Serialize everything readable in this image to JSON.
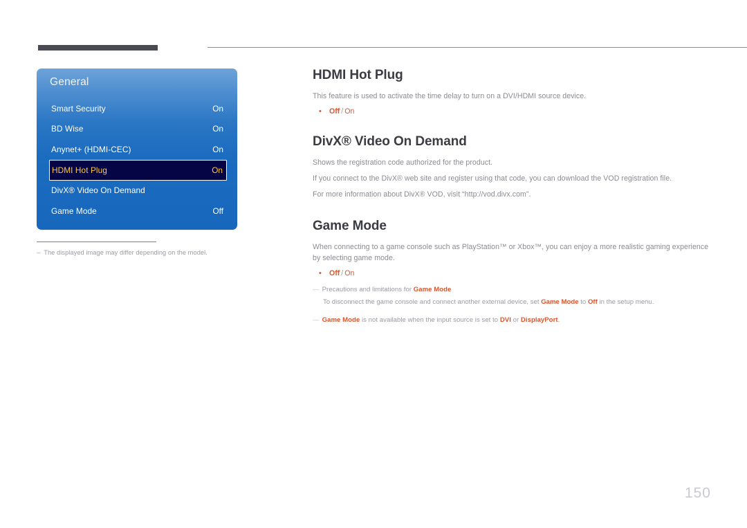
{
  "header": {
    "left_block": "",
    "right_rule": ""
  },
  "osd": {
    "title": "General",
    "rows": [
      {
        "label": "Smart Security",
        "value": "On",
        "selected": false
      },
      {
        "label": "BD Wise",
        "value": "On",
        "selected": false
      },
      {
        "label": "Anynet+ (HDMI-CEC)",
        "value": "On",
        "selected": false
      },
      {
        "label": "HDMI Hot Plug",
        "value": "On",
        "selected": true
      },
      {
        "label": "DivX® Video On Demand",
        "value": "",
        "selected": false
      },
      {
        "label": "Game Mode",
        "value": "Off",
        "selected": false
      }
    ],
    "footnote": {
      "dash": "–",
      "text": "The displayed image may differ depending on the model."
    },
    "colors": {
      "highlight_bg": "#050546",
      "highlight_text": "#ffc83c",
      "panel_blue": "#1b6bbf"
    }
  },
  "content": {
    "section1": {
      "heading": "HDMI Hot Plug",
      "paragraph": "This feature is used to activate the time delay to turn on a DVI/HDMI source device.",
      "bullet": {
        "marker": "•",
        "option_a": "Off",
        "separator": "/",
        "option_b": "On"
      }
    },
    "section2": {
      "heading": "DivX® Video On Demand",
      "paragraph1": "Shows the registration code authorized for the product.",
      "paragraph2": "If you connect to the DivX® web site and register using that code, you can download the VOD registration file.",
      "paragraph3": "For more information about DivX® VOD, visit “http://vod.divx.com”."
    },
    "section3": {
      "heading": "Game Mode",
      "paragraph": "When connecting to a game console such as PlayStation™ or Xbox™, you can enjoy a more realistic gaming experience by selecting game mode.",
      "bullet": {
        "marker": "•",
        "option_a": "Off",
        "separator": "/",
        "option_b": "On"
      },
      "note1": {
        "dash": "—",
        "prefix": "Precautions and limitations for ",
        "term": "Game Mode",
        "sub_prefix": "To disconnect the game console and connect another external device, set ",
        "sub_term1": "Game Mode",
        "sub_mid": " to ",
        "sub_term2": "Off",
        "sub_suffix": " in the setup menu."
      },
      "note2": {
        "dash": "—",
        "term1": "Game Mode",
        "mid": " is not available when the input source is set to ",
        "term2": "DVI",
        "conj": " or ",
        "term3": "DisplayPort",
        "end": "."
      }
    }
  },
  "footer": {
    "page_number": "150"
  },
  "theme": {
    "accent": "#d8562f",
    "body_text": "#8b8b93",
    "heading": "#3b3b44",
    "page_number": "#c9c9d6"
  }
}
